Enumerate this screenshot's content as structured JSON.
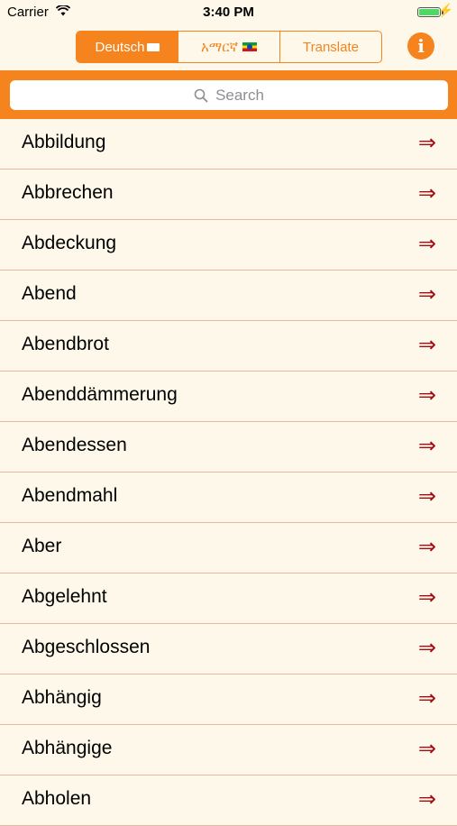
{
  "status_bar": {
    "carrier": "Carrier",
    "time": "3:40 PM"
  },
  "segments": [
    {
      "label": "Deutsch",
      "active": true
    },
    {
      "label": "አማርኛ",
      "active": false
    },
    {
      "label": "Translate",
      "active": false
    }
  ],
  "info_glyph": "i",
  "search": {
    "placeholder": "Search"
  },
  "words": [
    "Abbildung",
    "Abbrechen",
    "Abdeckung",
    "Abend",
    "Abendbrot",
    "Abenddämmerung",
    "Abendessen",
    "Abendmahl",
    "Aber",
    "Abgelehnt",
    "Abgeschlossen",
    "Abhängig",
    "Abhängige",
    "Abholen"
  ],
  "row_arrow": "⇒",
  "colors": {
    "accent": "#f5841f",
    "background": "#fdf8e9",
    "arrow": "#a10d12",
    "separator": "#f3b49d"
  }
}
